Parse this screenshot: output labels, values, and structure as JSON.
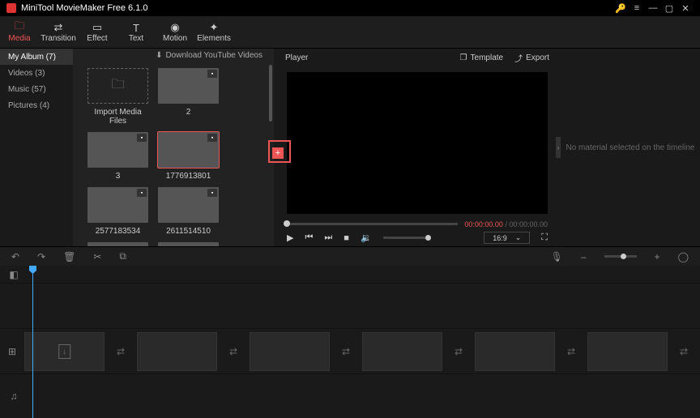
{
  "app": {
    "title": "MiniTool MovieMaker Free 6.1.0"
  },
  "toolbar": {
    "items": [
      {
        "label": "Media",
        "icon": "🗀"
      },
      {
        "label": "Transition",
        "icon": "⇄"
      },
      {
        "label": "Effect",
        "icon": "▭"
      },
      {
        "label": "Text",
        "icon": "T̲"
      },
      {
        "label": "Motion",
        "icon": "◉"
      },
      {
        "label": "Elements",
        "icon": "✦"
      }
    ]
  },
  "sidebar": {
    "items": [
      {
        "label": "My Album (7)"
      },
      {
        "label": "Videos (3)"
      },
      {
        "label": "Music (57)"
      },
      {
        "label": "Pictures (4)"
      }
    ]
  },
  "library": {
    "download": "Download YouTube Videos",
    "import": "Import Media Files",
    "items": [
      {
        "label": "2"
      },
      {
        "label": "3"
      },
      {
        "label": "1776913801"
      },
      {
        "label": "2577183534"
      },
      {
        "label": "2611514510"
      },
      {
        "label": ""
      },
      {
        "label": ""
      }
    ]
  },
  "player": {
    "title": "Player",
    "template": "Template",
    "export": "Export",
    "time_current": "00:00:00.00",
    "time_sep": " / ",
    "time_total": "00:00:00.00",
    "ratio": "16:9"
  },
  "inspector": {
    "empty": "No material selected on the timeline"
  }
}
